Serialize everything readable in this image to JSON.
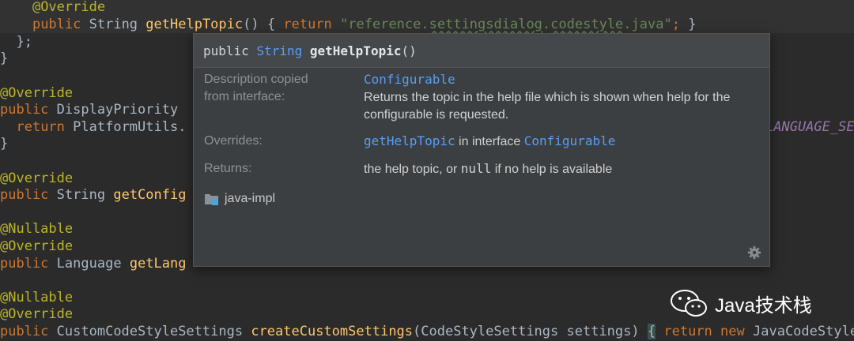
{
  "editor": {
    "lines": {
      "l1_ann": "@Override",
      "l2_kw": "public",
      "l2_type": "String",
      "l2_fn": "getHelpTopic",
      "l2_paren": "()",
      "l2_brace_open": "{",
      "l2_ret": "return",
      "l2_str_a": "\"reference.",
      "l2_str_b": "settingsdialog",
      "l2_str_c": ".",
      "l2_str_d": "codestyle",
      "l2_str_e": ".java\"",
      "l2_semi": ";",
      "l2_brace_close": "}",
      "l3": "};",
      "l4": "}",
      "l6_ann": "@Override",
      "l7_kw": "public",
      "l7_rest": "DisplayPriority",
      "l8_kw": "return",
      "l8_rest": "PlatformUtils.",
      "l8_const": "LANGUAGE_SET",
      "l9": "}",
      "l11_ann": "@Override",
      "l12_kw": "public",
      "l12_type": "String",
      "l12_fn": "getConfig",
      "l14_ann": "@Nullable",
      "l15_ann": "@Override",
      "l16_kw": "public",
      "l16_type": "Language",
      "l16_fn": "getLang",
      "l18_ann": "@Nullable",
      "l19_ann": "@Override",
      "l20_kw": "public",
      "l20_type": "CustomCodeStyleSettings",
      "l20_fn": "createCustomSettings",
      "l20_args": "(CodeStyleSettings settings)",
      "l20_brace": "{",
      "l20_ret": "return",
      "l20_new": "new",
      "l20_tail": "JavaCodeStyle"
    }
  },
  "popup": {
    "signature": {
      "kw": "public",
      "type": "String",
      "name": "getHelpTopic",
      "parens": "()"
    },
    "description_label_1": "Description copied",
    "description_label_2": "from interface:",
    "description_link": "Configurable",
    "description_text": "Returns the topic in the help file which is shown when help for the configurable is requested.",
    "overrides_label": "Overrides:",
    "overrides_method": "getHelpTopic",
    "overrides_mid": " in interface ",
    "overrides_interface": "Configurable",
    "returns_label": "Returns:",
    "returns_text_a": "the help topic, or ",
    "returns_null": "null",
    "returns_text_b": " if no help is available",
    "module": "java-impl",
    "icons": {
      "module": "module-folder-icon",
      "settings": "gear-icon"
    }
  },
  "watermark": {
    "text": "Java技术栈",
    "icon": "wechat-icon"
  },
  "colors": {
    "background": "#2b2b2b",
    "keyword": "#cc7832",
    "annotation": "#bbb529",
    "string": "#6a8759",
    "function": "#ffc66d",
    "link": "#589df6",
    "popup_bg": "#3c3f41"
  }
}
